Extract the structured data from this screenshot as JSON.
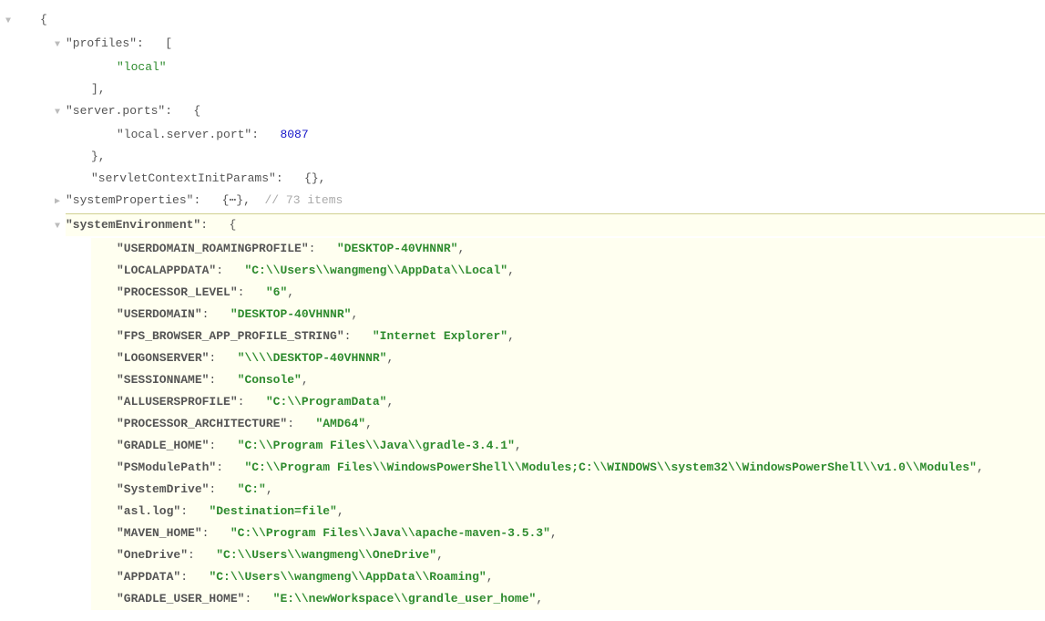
{
  "arrows": {
    "down": "▼",
    "right": "▶"
  },
  "line1_brace": "{",
  "profiles_key": "\"profiles\"",
  "profiles_open": ":   [",
  "profiles_val": "\"local\"",
  "profiles_close": "],",
  "serverports_key": "\"server.ports\"",
  "serverports_open": ":   {",
  "serverports_inner_key": "\"local.server.port\"",
  "serverports_inner_colon": ":   ",
  "serverports_inner_val": "8087",
  "serverports_close": "},",
  "servlet_key": "\"servletContextInitParams\"",
  "servlet_rest": ":   {},",
  "sysprops_key": "\"systemProperties\"",
  "sysprops_colon": ":   {",
  "sysprops_dots": "⋯",
  "sysprops_close": "},  ",
  "sysprops_comment": "// 73 items",
  "sysenv_key": "\"systemEnvironment\"",
  "sysenv_open": ":   {",
  "env": [
    {
      "k": "\"USERDOMAIN_ROAMINGPROFILE\"",
      "v": "\"DESKTOP-40VHNNR\""
    },
    {
      "k": "\"LOCALAPPDATA\"",
      "v": "\"C:\\\\Users\\\\wangmeng\\\\AppData\\\\Local\""
    },
    {
      "k": "\"PROCESSOR_LEVEL\"",
      "v": "\"6\""
    },
    {
      "k": "\"USERDOMAIN\"",
      "v": "\"DESKTOP-40VHNNR\""
    },
    {
      "k": "\"FPS_BROWSER_APP_PROFILE_STRING\"",
      "v": "\"Internet Explorer\""
    },
    {
      "k": "\"LOGONSERVER\"",
      "v": "\"\\\\\\\\DESKTOP-40VHNNR\""
    },
    {
      "k": "\"SESSIONNAME\"",
      "v": "\"Console\""
    },
    {
      "k": "\"ALLUSERSPROFILE\"",
      "v": "\"C:\\\\ProgramData\""
    },
    {
      "k": "\"PROCESSOR_ARCHITECTURE\"",
      "v": "\"AMD64\""
    },
    {
      "k": "\"GRADLE_HOME\"",
      "v": "\"C:\\\\Program Files\\\\Java\\\\gradle-3.4.1\""
    },
    {
      "k": "\"PSModulePath\"",
      "v": "\"C:\\\\Program Files\\\\WindowsPowerShell\\\\Modules;C:\\\\WINDOWS\\\\system32\\\\WindowsPowerShell\\\\v1.0\\\\Modules\""
    },
    {
      "k": "\"SystemDrive\"",
      "v": "\"C:\""
    },
    {
      "k": "\"asl.log\"",
      "v": "\"Destination=file\""
    },
    {
      "k": "\"MAVEN_HOME\"",
      "v": "\"C:\\\\Program Files\\\\Java\\\\apache-maven-3.5.3\""
    },
    {
      "k": "\"OneDrive\"",
      "v": "\"C:\\\\Users\\\\wangmeng\\\\OneDrive\""
    },
    {
      "k": "\"APPDATA\"",
      "v": "\"C:\\\\Users\\\\wangmeng\\\\AppData\\\\Roaming\""
    },
    {
      "k": "\"GRADLE_USER_HOME\"",
      "v": "\"E:\\\\newWorkspace\\\\grandle_user_home\""
    }
  ]
}
